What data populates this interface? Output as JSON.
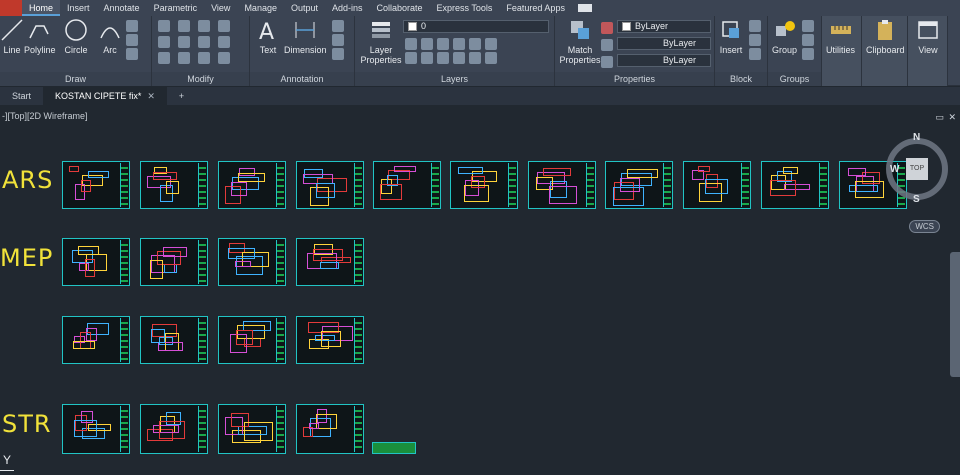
{
  "menu": {
    "tabs": [
      "Home",
      "Insert",
      "Annotate",
      "Parametric",
      "View",
      "Manage",
      "Output",
      "Add-ins",
      "Collaborate",
      "Express Tools",
      "Featured Apps"
    ],
    "active": "Home"
  },
  "ribbon": {
    "draw": {
      "title": "Draw",
      "tools": [
        "Line",
        "Polyline",
        "Circle",
        "Arc"
      ]
    },
    "modify": {
      "title": "Modify"
    },
    "annotation": {
      "title": "Annotation",
      "tools": [
        "Text",
        "Dimension"
      ]
    },
    "layers": {
      "title": "Layers",
      "layer_properties": "Layer Properties",
      "layer_value": "0"
    },
    "properties": {
      "title": "Properties",
      "match": "Match Properties",
      "color": "ByLayer",
      "linetype": "ByLayer",
      "lineweight": "ByLayer"
    },
    "block": {
      "title": "Block",
      "insert": "Insert"
    },
    "groups": {
      "title": "Groups",
      "group": "Group"
    },
    "utilities": "Utilities",
    "clipboard": "Clipboard",
    "view": "View"
  },
  "file_tabs": [
    "Start",
    "KOSTAN CIPETE fix*"
  ],
  "viewport": {
    "label": "-][Top][2D Wireframe]",
    "rows": [
      "ARS",
      "MEP",
      "STR"
    ],
    "wcs": "WCS",
    "compass": {
      "n": "N",
      "w": "W",
      "s": "S",
      "face": "TOP"
    },
    "ucs_y": "Y"
  },
  "colors": {
    "sheet_border": "#21c4c4",
    "label": "#f1e23a",
    "bg": "#212830"
  }
}
